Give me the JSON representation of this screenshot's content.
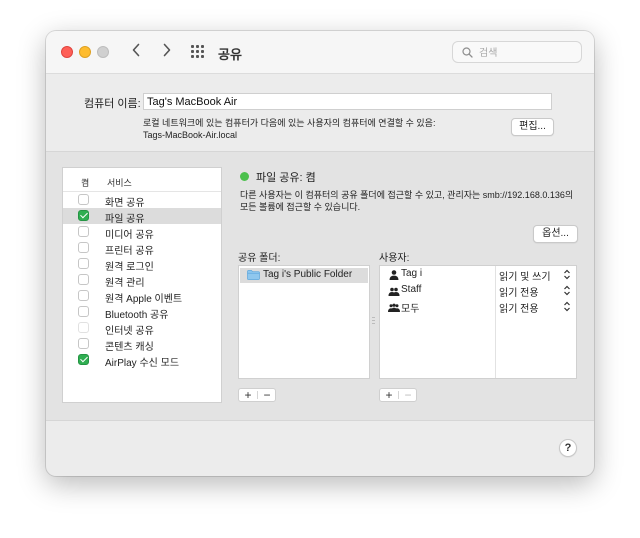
{
  "window": {
    "title": "공유"
  },
  "search": {
    "placeholder": "검색"
  },
  "computer": {
    "label": "컴퓨터 이름:",
    "name": "Tag's MacBook Air",
    "desc_line1": "로컬 네트워크에 있는 컴퓨터가 다음에 있는 사용자의 컴퓨터에 연결할 수 있음:",
    "desc_line2": "Tags-MacBook-Air.local",
    "edit_label": "편집..."
  },
  "services": {
    "header_on": "켬",
    "header_service": "서비스",
    "items": [
      {
        "label": "화면 공유",
        "checked": false
      },
      {
        "label": "파일 공유",
        "checked": true,
        "selected": true
      },
      {
        "label": "미디어 공유",
        "checked": false
      },
      {
        "label": "프린터 공유",
        "checked": false
      },
      {
        "label": "원격 로그인",
        "checked": false
      },
      {
        "label": "원격 관리",
        "checked": false
      },
      {
        "label": "원격 Apple 이벤트",
        "checked": false
      },
      {
        "label": "Bluetooth 공유",
        "checked": false
      },
      {
        "label": "인터넷 공유",
        "checked": false,
        "disabled": true
      },
      {
        "label": "콘텐츠 캐싱",
        "checked": false
      },
      {
        "label": "AirPlay 수신 모드",
        "checked": true
      }
    ]
  },
  "detail": {
    "status": "파일 공유: 켬",
    "status_color": "#4cc04d",
    "info_line1": "다른 사용자는 이 컴퓨터의 공유 폴더에 접근할 수 있고, 관리자는 smb://192.168.0.136의",
    "info_line2": "모든 볼륨에 접근할 수 있습니다.",
    "options_label": "옵션...",
    "shared_folders_label": "공유 폴더:",
    "users_label": "사용자:",
    "shared_folders": [
      "Tag i's Public Folder"
    ],
    "users": [
      {
        "name": "Tag i",
        "permission": "읽기 및 쓰기",
        "icon": "user-icon"
      },
      {
        "name": "Staff",
        "permission": "읽기 전용",
        "icon": "group-icon"
      },
      {
        "name": "모두",
        "permission": "읽기 전용",
        "icon": "everyone-icon"
      }
    ],
    "plus": "+",
    "minus": "−"
  },
  "help": "?"
}
